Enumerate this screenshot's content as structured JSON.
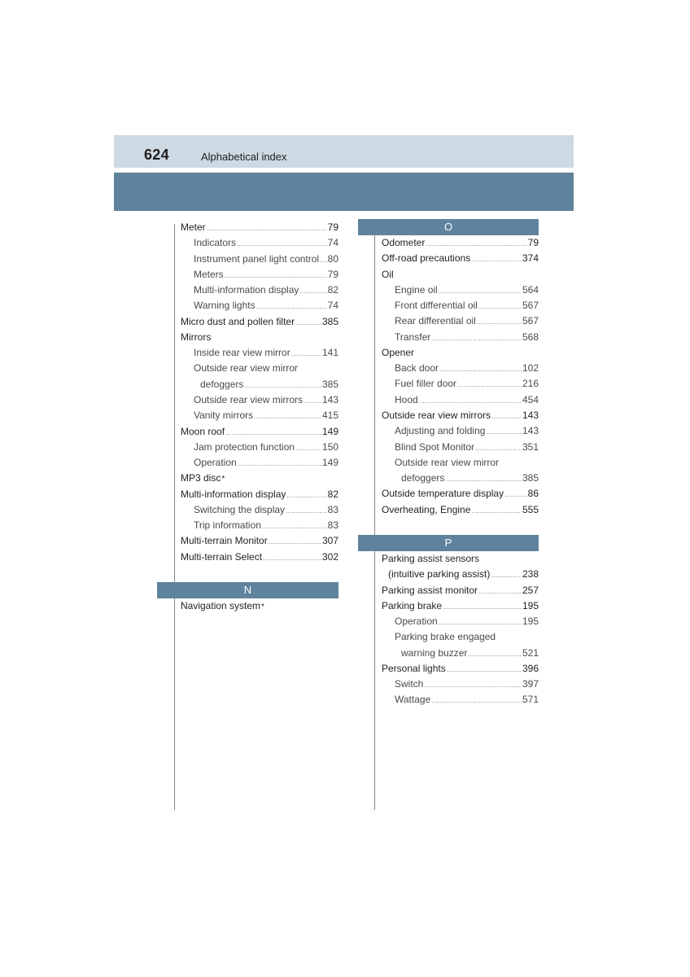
{
  "header": {
    "page_number": "624",
    "title": "Alphabetical index"
  },
  "colors": {
    "header_light": "#cdd9e3",
    "header_dark": "#5f839d",
    "letter_bar": "#5f839d"
  },
  "left_column": {
    "entries": [
      {
        "label": "Meter",
        "page": "79",
        "level": 0
      },
      {
        "label": "Indicators",
        "page": "74",
        "level": 1
      },
      {
        "label": "Instrument panel light control",
        "page": "80",
        "level": 1
      },
      {
        "label": "Meters",
        "page": "79",
        "level": 1
      },
      {
        "label": "Multi-information display",
        "page": "82",
        "level": 1
      },
      {
        "label": "Warning lights",
        "page": "74",
        "level": 1
      },
      {
        "label": "Micro dust and pollen filter",
        "page": "385",
        "level": 0
      },
      {
        "label": "Mirrors",
        "page": "",
        "level": 0
      },
      {
        "label": "Inside rear view mirror",
        "page": "141",
        "level": 1
      },
      {
        "label": "Outside rear view mirror",
        "page": "",
        "level": 1
      },
      {
        "label": "defoggers",
        "page": "385",
        "level": 2
      },
      {
        "label": "Outside rear view mirrors",
        "page": "143",
        "level": 1
      },
      {
        "label": "Vanity mirrors",
        "page": "415",
        "level": 1
      },
      {
        "label": "Moon roof",
        "page": "149",
        "level": 0
      },
      {
        "label": "Jam protection function",
        "page": "150",
        "level": 1
      },
      {
        "label": "Operation",
        "page": "149",
        "level": 1
      },
      {
        "label": "MP3 disc",
        "page": "",
        "level": 0,
        "asterisk": "*"
      },
      {
        "label": "Multi-information display",
        "page": "82",
        "level": 0
      },
      {
        "label": "Switching the display",
        "page": "83",
        "level": 1
      },
      {
        "label": "Trip information",
        "page": "83",
        "level": 1
      },
      {
        "label": "Multi-terrain Monitor",
        "page": "307",
        "level": 0
      },
      {
        "label": "Multi-terrain Select",
        "page": "302",
        "level": 0
      }
    ],
    "section_n": {
      "letter": "N",
      "entries": [
        {
          "label": "Navigation system",
          "page": "",
          "level": 0,
          "asterisk": "*"
        }
      ]
    }
  },
  "right_column": {
    "section_o": {
      "letter": "O",
      "entries": [
        {
          "label": "Odometer",
          "page": "79",
          "level": 0
        },
        {
          "label": "Off-road precautions",
          "page": "374",
          "level": 0
        },
        {
          "label": "Oil",
          "page": "",
          "level": 0
        },
        {
          "label": "Engine oil",
          "page": "564",
          "level": 1
        },
        {
          "label": "Front differential oil",
          "page": "567",
          "level": 1
        },
        {
          "label": "Rear differential oil",
          "page": "567",
          "level": 1
        },
        {
          "label": "Transfer",
          "page": "568",
          "level": 1
        },
        {
          "label": "Opener",
          "page": "",
          "level": 0
        },
        {
          "label": "Back door",
          "page": "102",
          "level": 1
        },
        {
          "label": "Fuel filler door",
          "page": "216",
          "level": 1
        },
        {
          "label": "Hood",
          "page": "454",
          "level": 1
        },
        {
          "label": "Outside rear view mirrors",
          "page": "143",
          "level": 0
        },
        {
          "label": "Adjusting and folding",
          "page": "143",
          "level": 1
        },
        {
          "label": "Blind Spot Monitor",
          "page": "351",
          "level": 1
        },
        {
          "label": "Outside rear view mirror",
          "page": "",
          "level": 1
        },
        {
          "label": "defoggers",
          "page": "385",
          "level": 2
        },
        {
          "label": "Outside temperature display",
          "page": "86",
          "level": 0
        },
        {
          "label": "Overheating, Engine",
          "page": "555",
          "level": 0
        }
      ]
    },
    "section_p": {
      "letter": "P",
      "entries": [
        {
          "label": "Parking assist sensors",
          "page": "",
          "level": 0
        },
        {
          "label": "(intuitive parking assist)",
          "page": "238",
          "level": 3
        },
        {
          "label": "Parking assist monitor",
          "page": "257",
          "level": 0
        },
        {
          "label": "Parking brake",
          "page": "195",
          "level": 0
        },
        {
          "label": "Operation",
          "page": "195",
          "level": 1
        },
        {
          "label": "Parking brake engaged",
          "page": "",
          "level": 1
        },
        {
          "label": "warning buzzer",
          "page": "521",
          "level": 2
        },
        {
          "label": "Personal lights",
          "page": "396",
          "level": 0
        },
        {
          "label": "Switch",
          "page": "397",
          "level": 1
        },
        {
          "label": "Wattage",
          "page": "571",
          "level": 1
        }
      ]
    }
  }
}
